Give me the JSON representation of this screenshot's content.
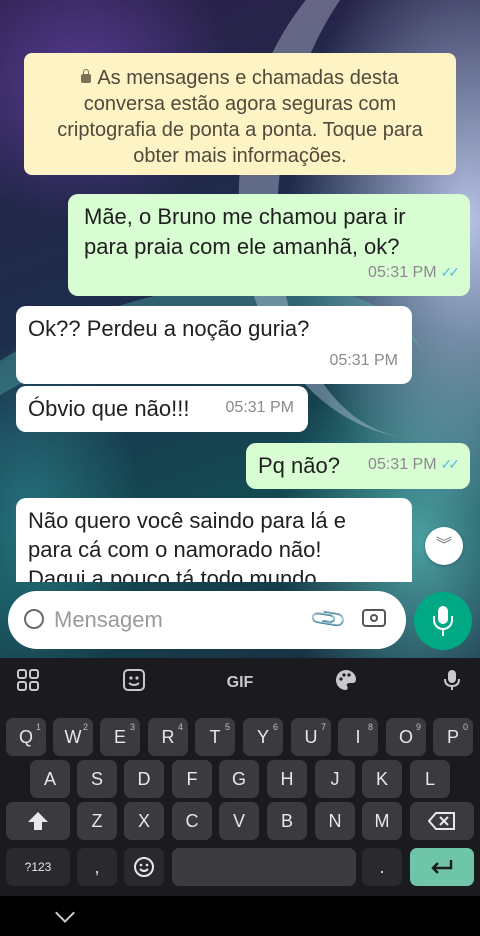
{
  "encryption_notice": "As mensagens e chamadas desta conversa estão agora seguras com criptografia de ponta a ponta. Toque para obter mais informações.",
  "messages": [
    {
      "direction": "out",
      "text": "Mãe, o Bruno me chamou para ir para praia com ele amanhã, ok?",
      "time": "05:31 PM",
      "status": "read"
    },
    {
      "direction": "in",
      "text": "Ok?? Perdeu a noção guria?",
      "time": "05:31 PM"
    },
    {
      "direction": "in",
      "text": "Óbvio que não!!!",
      "time": "05:31 PM"
    },
    {
      "direction": "out",
      "text": "Pq não?",
      "time": "05:31 PM",
      "status": "read"
    },
    {
      "direction": "in",
      "text": "Não quero você saindo para lá e para cá com o namorado não! Daqui a pouco tá todo mundo",
      "time": ""
    }
  ],
  "compose": {
    "placeholder": "Mensagem"
  },
  "keyboard": {
    "toolbar": [
      "apps-grid-icon",
      "sticker-icon",
      "GIF",
      "palette-icon",
      "mic-icon"
    ],
    "gif_label": "GIF",
    "row1": [
      {
        "k": "Q",
        "s": "1"
      },
      {
        "k": "W",
        "s": "2"
      },
      {
        "k": "E",
        "s": "3"
      },
      {
        "k": "R",
        "s": "4"
      },
      {
        "k": "T",
        "s": "5"
      },
      {
        "k": "Y",
        "s": "6"
      },
      {
        "k": "U",
        "s": "7"
      },
      {
        "k": "I",
        "s": "8"
      },
      {
        "k": "O",
        "s": "9"
      },
      {
        "k": "P",
        "s": "0"
      }
    ],
    "row2": [
      "A",
      "S",
      "D",
      "F",
      "G",
      "H",
      "J",
      "K",
      "L"
    ],
    "row3": [
      "Z",
      "X",
      "C",
      "V",
      "B",
      "N",
      "M"
    ],
    "symbols_label": "?123",
    "comma_label": ","
  },
  "colors": {
    "outgoing": "#d9fdd3",
    "incoming": "#ffffff",
    "notice": "#fdf3c5",
    "accent": "#00a884",
    "read_ticks": "#53bdeb"
  }
}
